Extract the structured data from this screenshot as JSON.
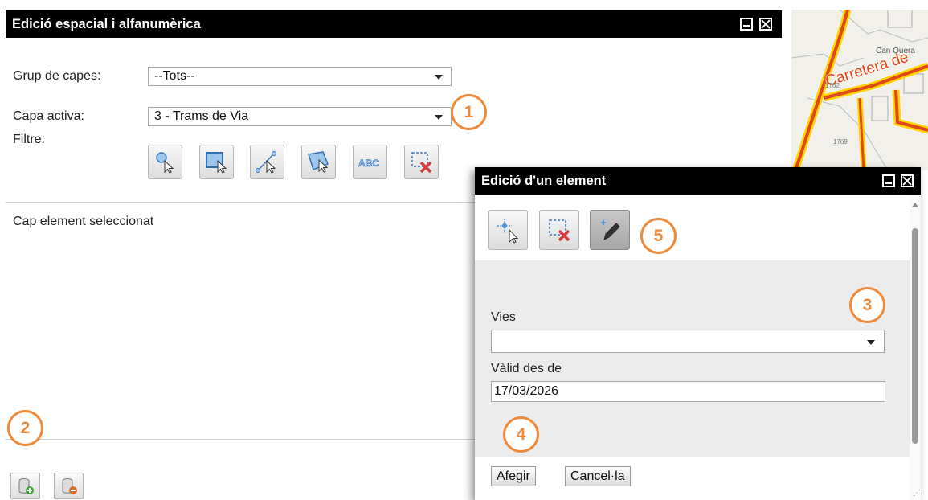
{
  "map": {
    "road_label": "Carretera de",
    "place_label": "Can Quera",
    "elevations": [
      "1762",
      "1769"
    ]
  },
  "main_window": {
    "title": "Edició espacial i alfanumèrica",
    "group_label": "Grup de capes:",
    "group_value": "--Tots--",
    "layer_label": "Capa activa:",
    "layer_value": "3 - Trams de Via",
    "filter_label": "Filtre:",
    "filter_tools": [
      "point-select-icon",
      "rectangle-select-icon",
      "line-select-icon",
      "polygon-select-icon",
      "text-abc-icon",
      "clear-selection-icon"
    ],
    "abc_text": "ABC",
    "status_text": "Cap element seleccionat",
    "bottom_buttons": [
      "add-layer-icon",
      "remove-layer-icon"
    ]
  },
  "edit_window": {
    "title": "Edició d'un element",
    "tools": [
      "move-vertex-icon",
      "clear-selection-icon",
      "edit-pencil-icon"
    ],
    "vies_label": "Vies",
    "vies_value": "",
    "valid_label": "Vàlid des de",
    "valid_value": "17/03/2026",
    "add_button": "Afegir",
    "cancel_button": "Cancel·la"
  },
  "callouts": [
    "1",
    "2",
    "3",
    "4",
    "5"
  ],
  "colors": {
    "titlebar": "#000000",
    "callout": "#ee8a3a",
    "map_road": "#e04818",
    "form_bg": "#ececec"
  }
}
